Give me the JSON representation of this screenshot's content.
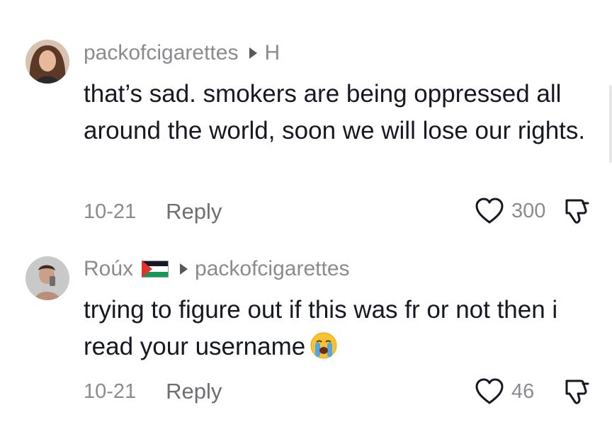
{
  "comments": [
    {
      "username": "packofcigarettes",
      "reply_to": "H",
      "text": "that’s sad. smokers are being oppressed all around the world, soon we will lose our rights.",
      "date": "10-21",
      "reply_label": "Reply",
      "likes": "300"
    },
    {
      "username": "Roúx",
      "reply_to": "packofcigarettes",
      "text": "trying to figure out if this was fr or not then i read your username",
      "date": "10-21",
      "reply_label": "Reply",
      "likes": "46"
    }
  ],
  "icons": {
    "like": "heart-outline-icon",
    "dislike": "thumbs-down-icon",
    "flag": "palestine-flag-icon",
    "emoji": "loudly-crying-face-emoji"
  },
  "colors": {
    "text": "#161823",
    "muted": "#8a8b91",
    "reply": "#6e6f75"
  }
}
